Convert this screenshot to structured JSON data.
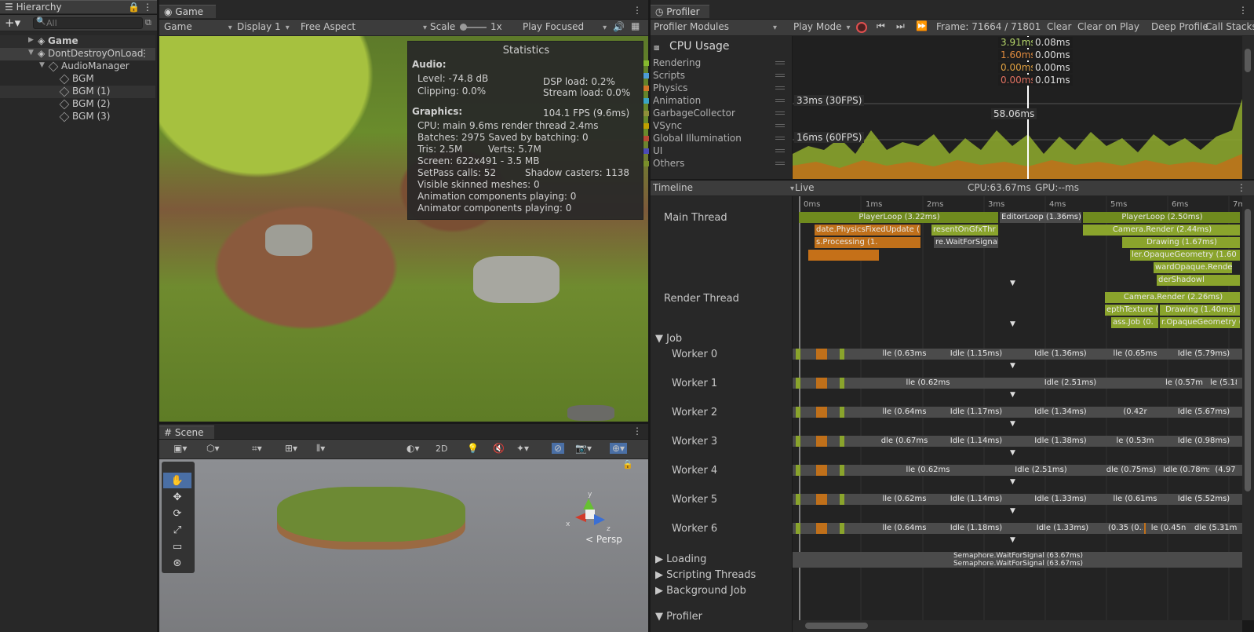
{
  "hierarchy": {
    "tab": "Hierarchy",
    "search_placeholder": "All",
    "items": [
      "Game",
      "DontDestroyOnLoad",
      "AudioManager",
      "BGM",
      "BGM (1)",
      "BGM (2)",
      "BGM (3)"
    ]
  },
  "game": {
    "tab": "Game",
    "toolbar": {
      "mode": "Game",
      "display": "Display 1",
      "aspect": "Free Aspect",
      "scale_label": "Scale",
      "scale_value": "1x",
      "play": "Play Focused"
    }
  },
  "stats": {
    "title": "Statistics",
    "audio_h": "Audio:",
    "level": "Level: -74.8 dB",
    "clipping": "Clipping: 0.0%",
    "dsp": "DSP load: 0.2%",
    "stream": "Stream load: 0.0%",
    "graphics_h": "Graphics:",
    "fps": "104.1 FPS (9.6ms)",
    "cpu": "CPU: main 9.6ms  render thread 2.4ms",
    "batches": "Batches: 2975   Saved by batching: 0",
    "tris": "Tris: 2.5M",
    "verts": "Verts: 5.7M",
    "screen": "Screen: 622x491 - 3.5 MB",
    "setpass": "SetPass calls: 52",
    "shadow": "Shadow casters: 1138",
    "skinned": "Visible skinned meshes: 0",
    "anim": "Animation components playing: 0",
    "animator": "Animator components playing: 0"
  },
  "scene": {
    "tab": "Scene",
    "mode2d": "2D",
    "persp": "< Persp",
    "gizmo_y": "y",
    "gizmo_x": "x",
    "gizmo_z": "z"
  },
  "profiler": {
    "tab": "Profiler",
    "modules": "Profiler Modules",
    "playmode": "Play Mode",
    "frame": "Frame: 71664 / 71801",
    "clear": "Clear",
    "clear_on_play": "Clear on Play",
    "deep": "Deep Profile",
    "callstack": "Call Stacks",
    "cpu_title": "CPU Usage",
    "legend": [
      {
        "name": "Rendering",
        "color": "#86b92e"
      },
      {
        "name": "Scripts",
        "color": "#4d9cd6"
      },
      {
        "name": "Physics",
        "color": "#d2762a"
      },
      {
        "name": "Animation",
        "color": "#3aa5c5"
      },
      {
        "name": "GarbageCollector",
        "color": "#8f8f3a"
      },
      {
        "name": "VSync",
        "color": "#c0a000"
      },
      {
        "name": "Global Illumination",
        "color": "#b84a35"
      },
      {
        "name": "UI",
        "color": "#4b4bb5"
      },
      {
        "name": "Others",
        "color": "#7a8f2a"
      }
    ],
    "readouts_left": [
      "3.91ms",
      "1.60ms",
      "0.00ms",
      "0.00ms"
    ],
    "readouts_right": [
      "0.08ms",
      "0.00ms",
      "0.00ms",
      "0.01ms"
    ],
    "fps30": "33ms (30FPS)",
    "fps60": "16ms (60FPS)",
    "cursor": "58.06ms",
    "timeline": "Timeline",
    "live": "Live",
    "cpu_time": "CPU:63.67ms",
    "gpu_time": "GPU:--ms",
    "ticks": [
      "0ms",
      "1ms",
      "2ms",
      "3ms",
      "4ms",
      "5ms",
      "6ms",
      "7m"
    ],
    "threads": {
      "main": "Main Thread",
      "render": "Render Thread",
      "job": "Job",
      "workers": [
        "Worker 0",
        "Worker 1",
        "Worker 2",
        "Worker 3",
        "Worker 4",
        "Worker 5",
        "Worker 6"
      ],
      "loading": "Loading",
      "scripting": "Scripting Threads",
      "background": "Background Job",
      "profiler": "Profiler"
    },
    "main_samples": [
      "PlayerLoop (3.22ms)",
      "EditorLoop (1.36ms)",
      "PlayerLoop (2.50ms)",
      "date.PhysicsFixedUpdate (",
      "resentOnGfxThr",
      "Camera.Render (2.44ms)",
      "s.Processing (1.",
      "re.WaitForSignal",
      "Drawing (1.67ms)",
      "ler.OpaqueGeometry (1.60",
      "wardOpaque.Rende",
      "derShadowl"
    ],
    "render_samples": [
      "Camera.Render (2.26ms)",
      "epthTexture (",
      "Drawing (1.40ms)",
      "ass.Job (0.",
      "r.OpaqueGeometry (1.38ms"
    ],
    "worker_samples": [
      [
        "lle (0.63ms",
        "Idle (1.15ms)",
        "Idle (1.36ms)",
        "lle (0.65ms",
        "Idle (5.79ms)"
      ],
      [
        "lle (0.62ms",
        "Idle (2.51ms)",
        "le (0.57m",
        "le (5.18m"
      ],
      [
        "lle (0.64ms",
        "Idle (1.17ms)",
        "Idle (1.34ms)",
        "(0.42r",
        "Idle (5.67ms)"
      ],
      [
        "dle (0.67ms",
        "Idle (1.14ms)",
        "Idle (1.38ms)",
        "le (0.53m",
        "Idle (0.98ms)"
      ],
      [
        "lle (0.62ms",
        "Idle (2.51ms)",
        "dle (0.75ms)",
        "Idle (0.78ms)",
        "(4.97"
      ],
      [
        "lle (0.62ms",
        "Idle (1.14ms)",
        "Idle (1.33ms)",
        "lle (0.61ms",
        "Idle (5.52ms)"
      ],
      [
        "lle (0.64ms",
        "Idle (1.18ms)",
        "Idle (1.33ms)",
        "(0.35 (0.35",
        "le (0.45n",
        "dle (5.31ms"
      ]
    ],
    "loading_samples": [
      "Semaphore.WaitForSignal (63.67ms)",
      "Semaphore.WaitForSignal (63.67ms)"
    ]
  }
}
